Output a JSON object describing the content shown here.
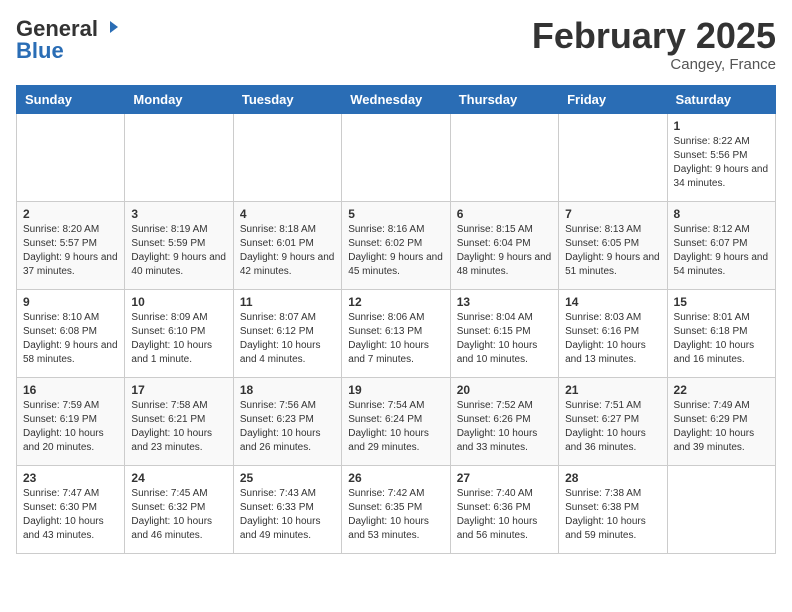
{
  "header": {
    "logo_line1": "General",
    "logo_line2": "Blue",
    "month_year": "February 2025",
    "location": "Cangey, France"
  },
  "days_of_week": [
    "Sunday",
    "Monday",
    "Tuesday",
    "Wednesday",
    "Thursday",
    "Friday",
    "Saturday"
  ],
  "weeks": [
    [
      {
        "day": "",
        "info": ""
      },
      {
        "day": "",
        "info": ""
      },
      {
        "day": "",
        "info": ""
      },
      {
        "day": "",
        "info": ""
      },
      {
        "day": "",
        "info": ""
      },
      {
        "day": "",
        "info": ""
      },
      {
        "day": "1",
        "info": "Sunrise: 8:22 AM\nSunset: 5:56 PM\nDaylight: 9 hours and 34 minutes."
      }
    ],
    [
      {
        "day": "2",
        "info": "Sunrise: 8:20 AM\nSunset: 5:57 PM\nDaylight: 9 hours and 37 minutes."
      },
      {
        "day": "3",
        "info": "Sunrise: 8:19 AM\nSunset: 5:59 PM\nDaylight: 9 hours and 40 minutes."
      },
      {
        "day": "4",
        "info": "Sunrise: 8:18 AM\nSunset: 6:01 PM\nDaylight: 9 hours and 42 minutes."
      },
      {
        "day": "5",
        "info": "Sunrise: 8:16 AM\nSunset: 6:02 PM\nDaylight: 9 hours and 45 minutes."
      },
      {
        "day": "6",
        "info": "Sunrise: 8:15 AM\nSunset: 6:04 PM\nDaylight: 9 hours and 48 minutes."
      },
      {
        "day": "7",
        "info": "Sunrise: 8:13 AM\nSunset: 6:05 PM\nDaylight: 9 hours and 51 minutes."
      },
      {
        "day": "8",
        "info": "Sunrise: 8:12 AM\nSunset: 6:07 PM\nDaylight: 9 hours and 54 minutes."
      }
    ],
    [
      {
        "day": "9",
        "info": "Sunrise: 8:10 AM\nSunset: 6:08 PM\nDaylight: 9 hours and 58 minutes."
      },
      {
        "day": "10",
        "info": "Sunrise: 8:09 AM\nSunset: 6:10 PM\nDaylight: 10 hours and 1 minute."
      },
      {
        "day": "11",
        "info": "Sunrise: 8:07 AM\nSunset: 6:12 PM\nDaylight: 10 hours and 4 minutes."
      },
      {
        "day": "12",
        "info": "Sunrise: 8:06 AM\nSunset: 6:13 PM\nDaylight: 10 hours and 7 minutes."
      },
      {
        "day": "13",
        "info": "Sunrise: 8:04 AM\nSunset: 6:15 PM\nDaylight: 10 hours and 10 minutes."
      },
      {
        "day": "14",
        "info": "Sunrise: 8:03 AM\nSunset: 6:16 PM\nDaylight: 10 hours and 13 minutes."
      },
      {
        "day": "15",
        "info": "Sunrise: 8:01 AM\nSunset: 6:18 PM\nDaylight: 10 hours and 16 minutes."
      }
    ],
    [
      {
        "day": "16",
        "info": "Sunrise: 7:59 AM\nSunset: 6:19 PM\nDaylight: 10 hours and 20 minutes."
      },
      {
        "day": "17",
        "info": "Sunrise: 7:58 AM\nSunset: 6:21 PM\nDaylight: 10 hours and 23 minutes."
      },
      {
        "day": "18",
        "info": "Sunrise: 7:56 AM\nSunset: 6:23 PM\nDaylight: 10 hours and 26 minutes."
      },
      {
        "day": "19",
        "info": "Sunrise: 7:54 AM\nSunset: 6:24 PM\nDaylight: 10 hours and 29 minutes."
      },
      {
        "day": "20",
        "info": "Sunrise: 7:52 AM\nSunset: 6:26 PM\nDaylight: 10 hours and 33 minutes."
      },
      {
        "day": "21",
        "info": "Sunrise: 7:51 AM\nSunset: 6:27 PM\nDaylight: 10 hours and 36 minutes."
      },
      {
        "day": "22",
        "info": "Sunrise: 7:49 AM\nSunset: 6:29 PM\nDaylight: 10 hours and 39 minutes."
      }
    ],
    [
      {
        "day": "23",
        "info": "Sunrise: 7:47 AM\nSunset: 6:30 PM\nDaylight: 10 hours and 43 minutes."
      },
      {
        "day": "24",
        "info": "Sunrise: 7:45 AM\nSunset: 6:32 PM\nDaylight: 10 hours and 46 minutes."
      },
      {
        "day": "25",
        "info": "Sunrise: 7:43 AM\nSunset: 6:33 PM\nDaylight: 10 hours and 49 minutes."
      },
      {
        "day": "26",
        "info": "Sunrise: 7:42 AM\nSunset: 6:35 PM\nDaylight: 10 hours and 53 minutes."
      },
      {
        "day": "27",
        "info": "Sunrise: 7:40 AM\nSunset: 6:36 PM\nDaylight: 10 hours and 56 minutes."
      },
      {
        "day": "28",
        "info": "Sunrise: 7:38 AM\nSunset: 6:38 PM\nDaylight: 10 hours and 59 minutes."
      },
      {
        "day": "",
        "info": ""
      }
    ]
  ]
}
